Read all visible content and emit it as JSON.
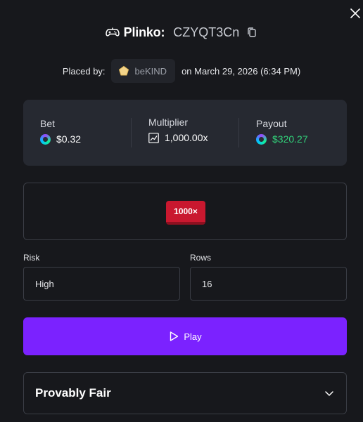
{
  "header": {
    "game_name": "Plinko:",
    "bet_id": "CZYQT3Cn",
    "icon": "gamepad-icon"
  },
  "placed": {
    "label": "Placed by:",
    "user": "beKIND",
    "date_text": "on March 29, 2026 (6:34 PM)"
  },
  "stats": {
    "bet_label": "Bet",
    "bet_value": "$0.32",
    "multiplier_label": "Multiplier",
    "multiplier_value": "1,000.00x",
    "payout_label": "Payout",
    "payout_value": "$320.27"
  },
  "result": {
    "multiplier_tile": "1000×"
  },
  "fields": {
    "risk_label": "Risk",
    "risk_value": "High",
    "rows_label": "Rows",
    "rows_value": "16"
  },
  "actions": {
    "play_label": "Play"
  },
  "fairness": {
    "title": "Provably Fair"
  },
  "colors": {
    "accent": "#7b22ff",
    "payout": "#32d17a",
    "tile": "#c9182f",
    "background": "#17181c",
    "card": "#262931"
  }
}
